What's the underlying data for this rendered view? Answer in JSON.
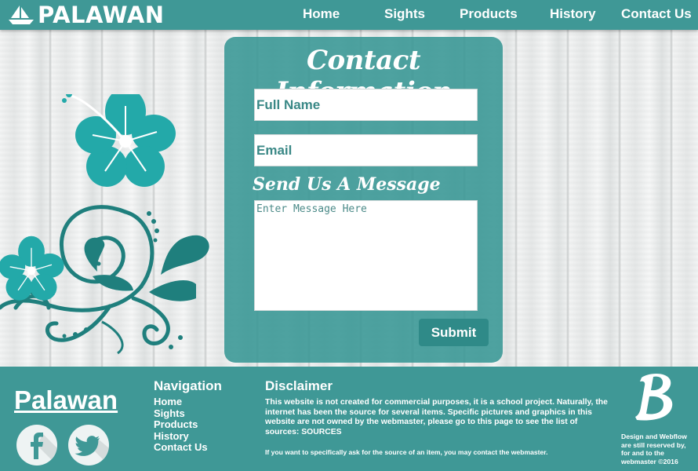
{
  "header": {
    "brand": "PALAWAN",
    "nav": [
      "Home",
      "Sights",
      "Products",
      "History",
      "Contact Us"
    ]
  },
  "contact": {
    "title": "Contact Information",
    "name_placeholder": "Full Name",
    "email_placeholder": "Email",
    "message_label": "Send Us A Message",
    "message_placeholder": "Enter Message Here",
    "submit": "Submit"
  },
  "footer": {
    "brand": "Palawan",
    "nav_title": "Navigation",
    "nav": [
      "Home",
      "Sights",
      "Products",
      "History",
      "Contact Us"
    ],
    "disclaimer_title": "Disclaimer",
    "disclaimer_text": "This website is not created for commercial purposes, it is a school project. Naturally, the internet has been the source for several items. Specific pictures and graphics in this website are not owned by the webmaster, please go to this page to see the list of sources: SOURCES",
    "disclaimer_note": "If you want to specifically ask for the source of an item, you may contact the webmaster.",
    "credit": "Design and Webflow are still reserved by, for and to the webmaster ©2016"
  },
  "colors": {
    "teal": "#3f9896",
    "teal_dark": "#2f8a88",
    "flower": "#23a9a9",
    "vine": "#1f7f7d"
  },
  "icons": [
    "boat-icon",
    "facebook-icon",
    "twitter-icon",
    "bootstrap-b-logo"
  ]
}
